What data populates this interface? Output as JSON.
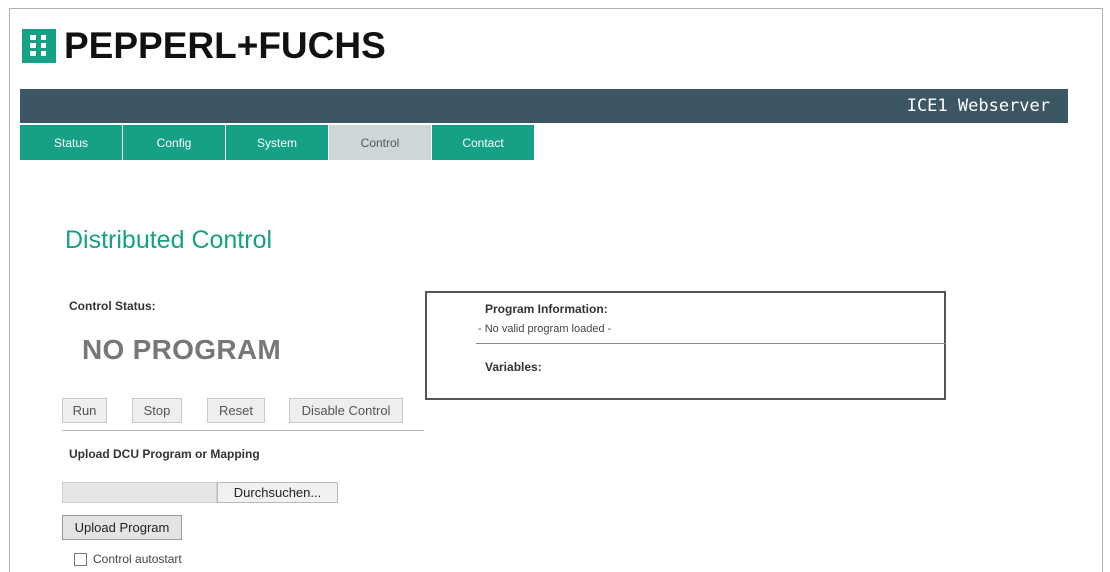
{
  "brand": {
    "logo_icon": "pepperl-fuchs-logo-mark",
    "name": "PEPPERL+FUCHS",
    "color": "#16a085"
  },
  "banner": {
    "title": "ICE1 Webserver",
    "color": "#3c5663"
  },
  "nav": {
    "tabs": [
      {
        "label": "Status",
        "active": false
      },
      {
        "label": "Config",
        "active": false
      },
      {
        "label": "System",
        "active": false
      },
      {
        "label": "Control",
        "active": true
      },
      {
        "label": "Contact",
        "active": false
      }
    ]
  },
  "page": {
    "title": "Distributed Control"
  },
  "control": {
    "status_label": "Control Status:",
    "status_value": "NO PROGRAM",
    "buttons": {
      "run": "Run",
      "stop": "Stop",
      "reset": "Reset",
      "disable": "Disable Control"
    }
  },
  "upload": {
    "label": "Upload DCU Program or Mapping",
    "file_value": "",
    "browse_label": "Durchsuchen...",
    "upload_button": "Upload Program",
    "autostart_label": "Control autostart",
    "autostart_checked": false
  },
  "program_info": {
    "title": "Program Information:",
    "text": "- No valid program loaded -",
    "variables_label": "Variables:"
  }
}
